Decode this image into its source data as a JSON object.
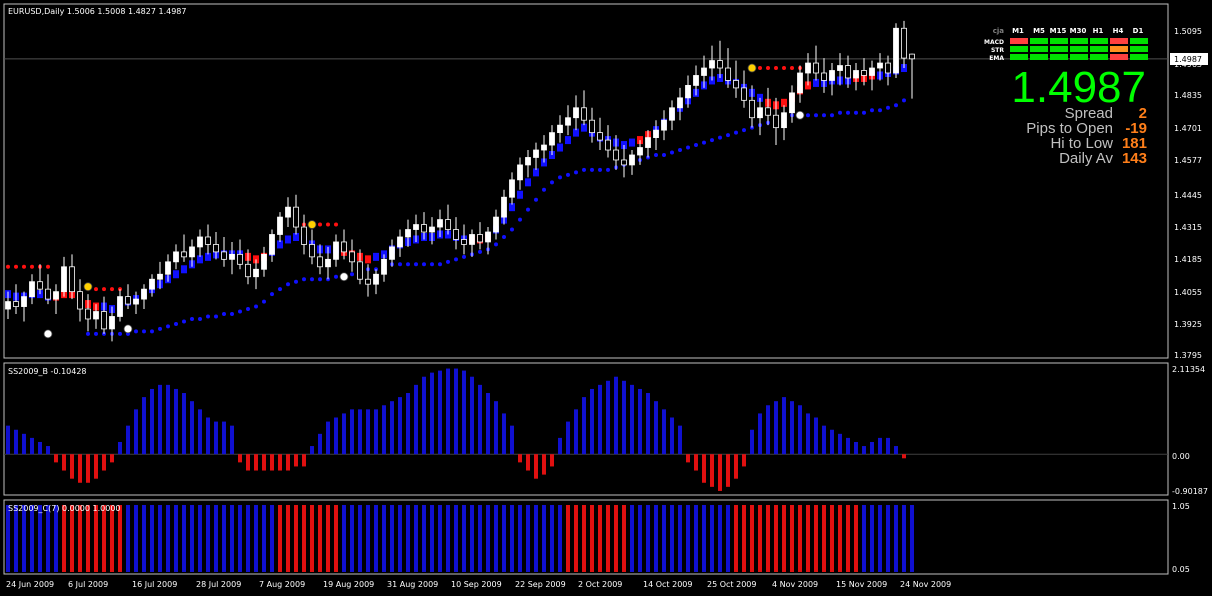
{
  "header": {
    "symbol_line": "EURUSD,Daily  1.5006 1.5008 1.4827 1.4987"
  },
  "price_axis": {
    "ticks": [
      "1.5095",
      "1.4963",
      "1.4835",
      "1.4701",
      "1.4577",
      "1.4445",
      "1.4315",
      "1.4185",
      "1.4055",
      "1.3925",
      "1.3795"
    ],
    "current_label": "1.4987"
  },
  "panel_b": {
    "title": "SS2009_B -0.10428",
    "ticks": [
      "2.11354",
      "0.00",
      "-0.90187"
    ]
  },
  "panel_c": {
    "title": "SS2009_C(7) 0.0000 1.0000",
    "ticks": [
      "1.05",
      "0.05"
    ]
  },
  "dates": [
    "24 Jun 2009",
    "6 Jul 2009",
    "16 Jul 2009",
    "28 Jul 2009",
    "7 Aug 2009",
    "19 Aug 2009",
    "31 Aug 2009",
    "10 Sep 2009",
    "22 Sep 2009",
    "2 Oct 2009",
    "14 Oct 2009",
    "25 Oct 2009",
    "4 Nov 2009",
    "15 Nov 2009",
    "24 Nov 2009"
  ],
  "dashboard": {
    "corner": "cja",
    "timeframes": [
      "M1",
      "M5",
      "M15",
      "M30",
      "H1",
      "H4",
      "D1"
    ],
    "rows": [
      {
        "label": "MACD",
        "cells": [
          "#ff4040",
          "#00e000",
          "#00e000",
          "#00e000",
          "#00e000",
          "#ff4040",
          "#00e000"
        ]
      },
      {
        "label": "STR",
        "cells": [
          "#00e000",
          "#00e000",
          "#00e000",
          "#00e000",
          "#00e000",
          "#ff9020",
          "#00e000"
        ]
      },
      {
        "label": "EMA",
        "cells": [
          "#00e000",
          "#00e000",
          "#00e000",
          "#00e000",
          "#00e000",
          "#ff4040",
          "#00e000"
        ]
      }
    ],
    "price": "1.4987",
    "stats": [
      {
        "label": "Spread",
        "value": "2"
      },
      {
        "label": "Pips to Open",
        "value": "-19"
      },
      {
        "label": "Hi to Low",
        "value": "181"
      },
      {
        "label": "Daily Av",
        "value": "143"
      }
    ]
  },
  "colors": {
    "bull_candle": "#ffffff",
    "bear_candle": "#000000",
    "trend_up": "#1010ff",
    "trend_down": "#ff1010",
    "signal_dot_up": "#ffffff",
    "signal_dot_down": "#ffd000",
    "positive_bar": "#1010d0",
    "negative_bar": "#e01010",
    "big_price": "#00ff00",
    "stat_value": "#ff7f1a"
  },
  "chart_data": {
    "type": "candlestick",
    "y_range": [
      1.3795,
      1.5095
    ],
    "candles": [
      [
        1.398,
        1.405,
        1.394,
        1.401
      ],
      [
        1.401,
        1.408,
        1.396,
        1.399
      ],
      [
        1.399,
        1.405,
        1.393,
        1.403
      ],
      [
        1.403,
        1.412,
        1.4,
        1.409
      ],
      [
        1.409,
        1.416,
        1.404,
        1.406
      ],
      [
        1.406,
        1.412,
        1.4,
        1.402
      ],
      [
        1.402,
        1.408,
        1.396,
        1.405
      ],
      [
        1.405,
        1.419,
        1.403,
        1.415
      ],
      [
        1.415,
        1.42,
        1.402,
        1.405
      ],
      [
        1.405,
        1.41,
        1.393,
        1.398
      ],
      [
        1.398,
        1.404,
        1.389,
        1.394
      ],
      [
        1.394,
        1.4,
        1.39,
        1.397
      ],
      [
        1.397,
        1.403,
        1.388,
        1.39
      ],
      [
        1.39,
        1.399,
        1.385,
        1.395
      ],
      [
        1.395,
        1.406,
        1.393,
        1.403
      ],
      [
        1.403,
        1.408,
        1.398,
        1.4
      ],
      [
        1.4,
        1.405,
        1.396,
        1.402
      ],
      [
        1.402,
        1.408,
        1.398,
        1.406
      ],
      [
        1.406,
        1.412,
        1.403,
        1.41
      ],
      [
        1.41,
        1.417,
        1.406,
        1.412
      ],
      [
        1.412,
        1.42,
        1.409,
        1.417
      ],
      [
        1.417,
        1.424,
        1.414,
        1.421
      ],
      [
        1.421,
        1.428,
        1.417,
        1.419
      ],
      [
        1.419,
        1.426,
        1.415,
        1.423
      ],
      [
        1.423,
        1.43,
        1.419,
        1.427
      ],
      [
        1.427,
        1.432,
        1.42,
        1.424
      ],
      [
        1.424,
        1.429,
        1.418,
        1.421
      ],
      [
        1.421,
        1.427,
        1.415,
        1.418
      ],
      [
        1.418,
        1.425,
        1.412,
        1.42
      ],
      [
        1.42,
        1.426,
        1.414,
        1.416
      ],
      [
        1.416,
        1.422,
        1.408,
        1.411
      ],
      [
        1.411,
        1.418,
        1.406,
        1.414
      ],
      [
        1.414,
        1.423,
        1.411,
        1.42
      ],
      [
        1.42,
        1.43,
        1.417,
        1.428
      ],
      [
        1.428,
        1.437,
        1.425,
        1.435
      ],
      [
        1.435,
        1.443,
        1.431,
        1.439
      ],
      [
        1.439,
        1.444,
        1.428,
        1.431
      ],
      [
        1.431,
        1.436,
        1.42,
        1.424
      ],
      [
        1.424,
        1.43,
        1.416,
        1.419
      ],
      [
        1.419,
        1.424,
        1.412,
        1.415
      ],
      [
        1.415,
        1.423,
        1.41,
        1.418
      ],
      [
        1.418,
        1.428,
        1.415,
        1.425
      ],
      [
        1.425,
        1.43,
        1.418,
        1.421
      ],
      [
        1.421,
        1.426,
        1.413,
        1.417
      ],
      [
        1.417,
        1.422,
        1.408,
        1.41
      ],
      [
        1.41,
        1.416,
        1.403,
        1.408
      ],
      [
        1.408,
        1.414,
        1.404,
        1.412
      ],
      [
        1.412,
        1.42,
        1.409,
        1.418
      ],
      [
        1.418,
        1.426,
        1.415,
        1.423
      ],
      [
        1.423,
        1.43,
        1.419,
        1.427
      ],
      [
        1.427,
        1.434,
        1.423,
        1.43
      ],
      [
        1.43,
        1.436,
        1.425,
        1.432
      ],
      [
        1.432,
        1.437,
        1.426,
        1.429
      ],
      [
        1.429,
        1.435,
        1.424,
        1.431
      ],
      [
        1.431,
        1.438,
        1.427,
        1.434
      ],
      [
        1.434,
        1.44,
        1.428,
        1.43
      ],
      [
        1.43,
        1.435,
        1.422,
        1.426
      ],
      [
        1.426,
        1.432,
        1.42,
        1.424
      ],
      [
        1.424,
        1.43,
        1.419,
        1.428
      ],
      [
        1.428,
        1.433,
        1.422,
        1.425
      ],
      [
        1.425,
        1.431,
        1.42,
        1.429
      ],
      [
        1.429,
        1.438,
        1.426,
        1.435
      ],
      [
        1.435,
        1.446,
        1.432,
        1.443
      ],
      [
        1.443,
        1.453,
        1.44,
        1.45
      ],
      [
        1.45,
        1.459,
        1.446,
        1.456
      ],
      [
        1.456,
        1.462,
        1.451,
        1.459
      ],
      [
        1.459,
        1.465,
        1.454,
        1.462
      ],
      [
        1.462,
        1.468,
        1.457,
        1.464
      ],
      [
        1.464,
        1.472,
        1.46,
        1.469
      ],
      [
        1.469,
        1.476,
        1.465,
        1.472
      ],
      [
        1.472,
        1.48,
        1.468,
        1.475
      ],
      [
        1.475,
        1.484,
        1.47,
        1.479
      ],
      [
        1.479,
        1.486,
        1.472,
        1.474
      ],
      [
        1.474,
        1.479,
        1.465,
        1.469
      ],
      [
        1.469,
        1.475,
        1.462,
        1.466
      ],
      [
        1.466,
        1.472,
        1.459,
        1.462
      ],
      [
        1.462,
        1.468,
        1.454,
        1.458
      ],
      [
        1.458,
        1.464,
        1.451,
        1.456
      ],
      [
        1.456,
        1.462,
        1.452,
        1.46
      ],
      [
        1.46,
        1.466,
        1.456,
        1.463
      ],
      [
        1.463,
        1.47,
        1.459,
        1.467
      ],
      [
        1.467,
        1.474,
        1.462,
        1.47
      ],
      [
        1.47,
        1.478,
        1.466,
        1.474
      ],
      [
        1.474,
        1.482,
        1.47,
        1.479
      ],
      [
        1.479,
        1.487,
        1.474,
        1.483
      ],
      [
        1.483,
        1.492,
        1.479,
        1.488
      ],
      [
        1.488,
        1.496,
        1.484,
        1.492
      ],
      [
        1.492,
        1.5,
        1.487,
        1.495
      ],
      [
        1.495,
        1.504,
        1.49,
        1.498
      ],
      [
        1.498,
        1.506,
        1.491,
        1.495
      ],
      [
        1.495,
        1.503,
        1.487,
        1.49
      ],
      [
        1.49,
        1.498,
        1.483,
        1.487
      ],
      [
        1.487,
        1.494,
        1.479,
        1.482
      ],
      [
        1.482,
        1.488,
        1.471,
        1.475
      ],
      [
        1.475,
        1.483,
        1.468,
        1.479
      ],
      [
        1.479,
        1.487,
        1.472,
        1.476
      ],
      [
        1.476,
        1.483,
        1.464,
        1.471
      ],
      [
        1.471,
        1.48,
        1.466,
        1.477
      ],
      [
        1.477,
        1.488,
        1.473,
        1.485
      ],
      [
        1.485,
        1.496,
        1.481,
        1.493
      ],
      [
        1.493,
        1.501,
        1.488,
        1.497
      ],
      [
        1.497,
        1.504,
        1.49,
        1.493
      ],
      [
        1.493,
        1.499,
        1.485,
        1.49
      ],
      [
        1.49,
        1.497,
        1.484,
        1.494
      ],
      [
        1.494,
        1.501,
        1.488,
        1.496
      ],
      [
        1.496,
        1.5,
        1.487,
        1.491
      ],
      [
        1.491,
        1.497,
        1.486,
        1.494
      ],
      [
        1.494,
        1.499,
        1.488,
        1.492
      ],
      [
        1.492,
        1.498,
        1.486,
        1.495
      ],
      [
        1.495,
        1.501,
        1.49,
        1.497
      ],
      [
        1.497,
        1.5,
        1.488,
        1.493
      ],
      [
        1.493,
        1.513,
        1.491,
        1.511
      ],
      [
        1.511,
        1.514,
        1.495,
        1.499
      ],
      [
        1.5006,
        1.5008,
        1.4827,
        1.4987
      ]
    ],
    "trend_line": [
      1.404,
      1.403,
      1.403,
      1.404,
      1.404,
      1.403,
      1.403,
      1.404,
      1.404,
      1.403,
      1.4,
      1.399,
      1.399,
      1.398,
      1.399,
      1.401,
      1.402,
      1.404,
      1.406,
      1.408,
      1.41,
      1.412,
      1.414,
      1.416,
      1.418,
      1.419,
      1.42,
      1.42,
      1.42,
      1.42,
      1.419,
      1.418,
      1.419,
      1.421,
      1.424,
      1.426,
      1.427,
      1.426,
      1.424,
      1.422,
      1.422,
      1.422,
      1.421,
      1.42,
      1.419,
      1.418,
      1.419,
      1.42,
      1.422,
      1.424,
      1.425,
      1.426,
      1.427,
      1.427,
      1.428,
      1.428,
      1.427,
      1.426,
      1.426,
      1.426,
      1.427,
      1.43,
      1.434,
      1.439,
      1.444,
      1.449,
      1.453,
      1.457,
      1.46,
      1.463,
      1.466,
      1.469,
      1.471,
      1.469,
      1.467,
      1.466,
      1.465,
      1.464,
      1.465,
      1.466,
      1.468,
      1.47,
      1.473,
      1.476,
      1.479,
      1.482,
      1.485,
      1.488,
      1.49,
      1.491,
      1.49,
      1.489,
      1.487,
      1.485,
      1.483,
      1.481,
      1.48,
      1.481,
      1.483,
      1.486,
      1.488,
      1.489,
      1.489,
      1.49,
      1.49,
      1.49,
      1.491,
      1.491,
      1.492,
      1.492,
      1.493,
      1.494,
      1.495
    ],
    "trend_colors": "bbbbbbrrrrrrbbbbbbbbbbbbbbbbbbrrrbbbbbbbbbrrrrbbbbbbbbbbbbrrrbbbbbbbbbbbbbbbbbbrrbbbbbbbbbbbbbbrrrrrrbbbbbrrrbbbbbbbbbb",
    "support_line": [
      null,
      null,
      null,
      null,
      null,
      null,
      null,
      null,
      null,
      null,
      1.388,
      1.388,
      1.388,
      1.388,
      1.388,
      1.388,
      1.389,
      1.389,
      1.389,
      1.39,
      1.391,
      1.392,
      1.393,
      1.394,
      1.394,
      1.395,
      1.395,
      1.396,
      1.396,
      1.397,
      1.398,
      1.399,
      1.401,
      1.404,
      1.406,
      1.408,
      1.409,
      1.41,
      1.41,
      1.41,
      1.41,
      1.411,
      1.411,
      1.412,
      1.413,
      1.414,
      1.414,
      1.415,
      1.416,
      1.416,
      1.416,
      1.416,
      1.416,
      1.416,
      1.416,
      1.417,
      1.418,
      1.419,
      1.42,
      1.421,
      1.422,
      1.424,
      1.427,
      1.43,
      1.434,
      1.438,
      1.442,
      1.446,
      1.449,
      1.451,
      1.452,
      1.453,
      1.454,
      1.454,
      1.454,
      1.454,
      1.455,
      1.456,
      1.457,
      1.458,
      1.459,
      1.46,
      1.46,
      1.461,
      1.462,
      1.463,
      1.464,
      1.465,
      1.466,
      1.467,
      1.468,
      1.469,
      1.47,
      1.471,
      1.472,
      1.473,
      1.475,
      1.476,
      1.476,
      1.476,
      1.476,
      1.476,
      1.476,
      1.476,
      1.477,
      1.477,
      1.477,
      1.477,
      1.478,
      1.478,
      1.479,
      1.48,
      1.482
    ],
    "resistance_segments": [
      {
        "start": 0,
        "end": 5,
        "value": 1.415
      },
      {
        "start": 10,
        "end": 14,
        "value": 1.406
      },
      {
        "start": 37,
        "end": 41,
        "value": 1.432
      },
      {
        "start": 94,
        "end": 99,
        "value": 1.495
      }
    ],
    "signal_dots": [
      {
        "i": 5,
        "v": 1.388,
        "kind": "up"
      },
      {
        "i": 10,
        "v": 1.407,
        "kind": "down"
      },
      {
        "i": 15,
        "v": 1.39,
        "kind": "up"
      },
      {
        "i": 38,
        "v": 1.432,
        "kind": "down"
      },
      {
        "i": 42,
        "v": 1.411,
        "kind": "up"
      },
      {
        "i": 93,
        "v": 1.495,
        "kind": "down"
      },
      {
        "i": 99,
        "v": 1.476,
        "kind": "up"
      }
    ],
    "panel_b_range": [
      -0.90187,
      2.11354
    ],
    "panel_b_values": [
      0.7,
      0.6,
      0.5,
      0.4,
      0.3,
      0.2,
      -0.2,
      -0.4,
      -0.6,
      -0.7,
      -0.7,
      -0.6,
      -0.4,
      -0.2,
      0.3,
      0.7,
      1.1,
      1.4,
      1.6,
      1.7,
      1.7,
      1.6,
      1.5,
      1.3,
      1.1,
      0.9,
      0.8,
      0.8,
      0.7,
      -0.2,
      -0.4,
      -0.4,
      -0.4,
      -0.4,
      -0.4,
      -0.4,
      -0.3,
      -0.3,
      0.2,
      0.5,
      0.8,
      0.9,
      1.0,
      1.1,
      1.1,
      1.1,
      1.1,
      1.2,
      1.3,
      1.4,
      1.5,
      1.7,
      1.9,
      2.0,
      2.05,
      2.1,
      2.1,
      2.05,
      1.9,
      1.7,
      1.5,
      1.3,
      1.0,
      0.7,
      -0.2,
      -0.4,
      -0.6,
      -0.5,
      -0.3,
      0.4,
      0.8,
      1.1,
      1.4,
      1.6,
      1.7,
      1.8,
      1.9,
      1.8,
      1.7,
      1.6,
      1.5,
      1.3,
      1.1,
      0.9,
      0.7,
      -0.2,
      -0.4,
      -0.7,
      -0.8,
      -0.9,
      -0.8,
      -0.6,
      -0.3,
      0.6,
      1.0,
      1.2,
      1.3,
      1.4,
      1.3,
      1.2,
      1.0,
      0.9,
      0.7,
      0.6,
      0.5,
      0.4,
      0.3,
      0.2,
      0.3,
      0.4,
      0.4,
      0.2,
      -0.1
    ],
    "panel_c_values": "bbbbbbbrrrrrrrrbbbbbbbbbbbbbbbbbbbrrrrrrrrbbbbbbbbbbbbbbbbbbbbbbbbbbbbrrrrrrrrbbbbbbbbbbbbbrrrrrrrrrrrrrrrrbbbbbbbbbbbbbbbrrrbbbbbbbbbbbbbr",
    "date_ticks": [
      "24 Jun 2009",
      "6 Jul 2009",
      "16 Jul 2009",
      "28 Jul 2009",
      "7 Aug 2009",
      "19 Aug 2009",
      "31 Aug 2009",
      "10 Sep 2009",
      "22 Sep 2009",
      "2 Oct 2009",
      "14 Oct 2009",
      "25 Oct 2009",
      "4 Nov 2009",
      "15 Nov 2009",
      "24 Nov 2009"
    ]
  }
}
